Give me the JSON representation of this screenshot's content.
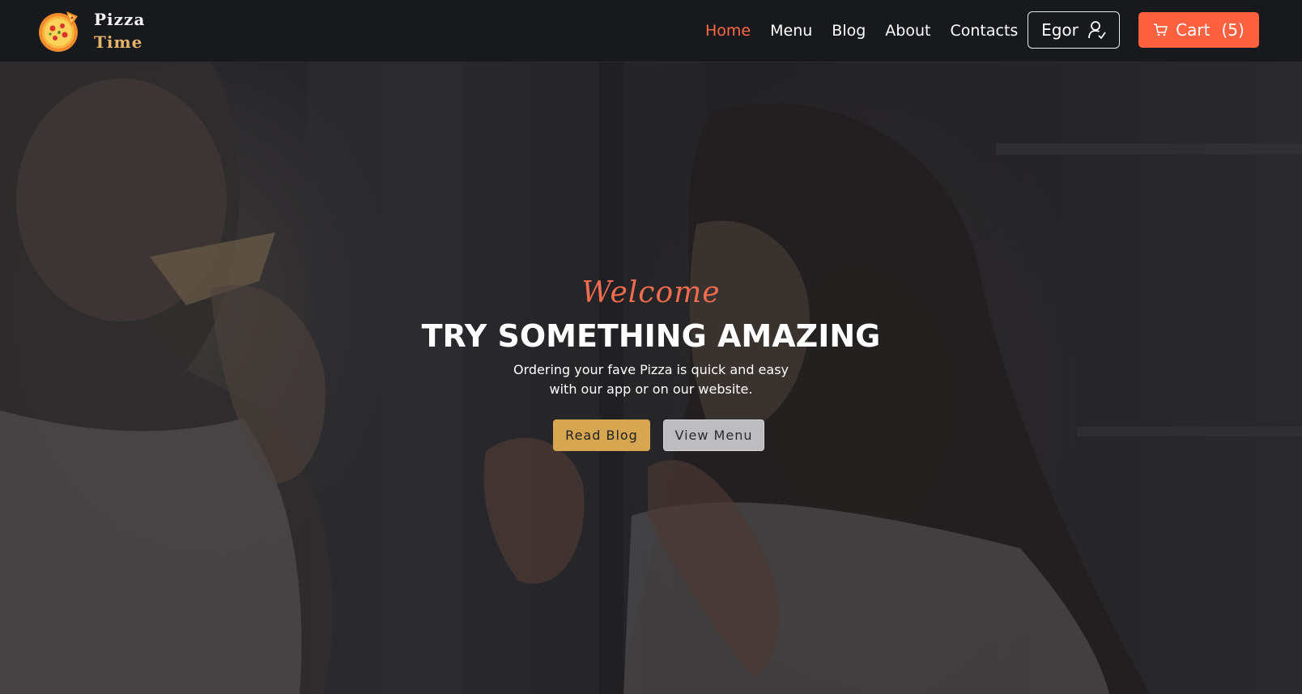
{
  "brand": {
    "line1": "Pizza",
    "line2": "Time",
    "logo_icon": "pizza-logo-icon"
  },
  "nav": {
    "items": [
      {
        "label": "Home",
        "active": true
      },
      {
        "label": "Menu",
        "active": false
      },
      {
        "label": "Blog",
        "active": false
      },
      {
        "label": "About",
        "active": false
      },
      {
        "label": "Contacts",
        "active": false
      }
    ]
  },
  "user": {
    "name": "Egor",
    "icon": "user-check-icon"
  },
  "cart": {
    "label": "Cart",
    "count": "(5)",
    "icon": "cart-icon"
  },
  "hero": {
    "welcome": "Welcome",
    "headline": "TRY SOMETHING AMAZING",
    "subtitle_line1": "Ordering your fave Pizza is quick and easy",
    "subtitle_line2": "with our app or on our website.",
    "primary_button": "Read Blog",
    "secondary_button": "View Menu"
  },
  "colors": {
    "accent": "#fe6140",
    "gold": "#d6a651",
    "header_bg": "#18191c",
    "active_nav": "#ff6a46"
  }
}
